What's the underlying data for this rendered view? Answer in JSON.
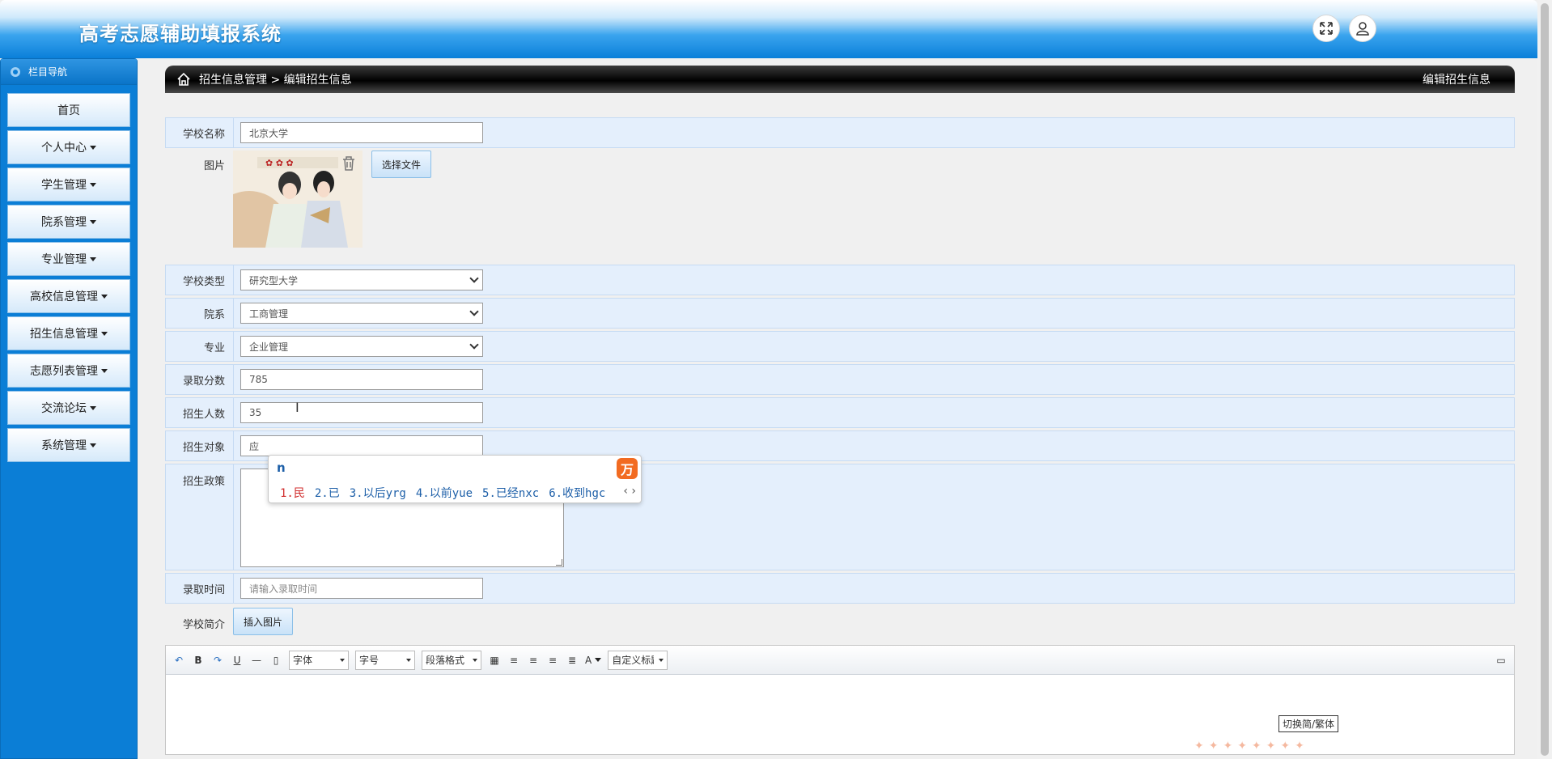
{
  "app": {
    "title": "高考志愿辅助填报系统"
  },
  "header": {
    "fullscreen_icon": "expand-arrows-icon",
    "user_icon": "user-icon"
  },
  "sidebar": {
    "heading": "栏目导航",
    "items": [
      {
        "label": "首页",
        "has_caret": false
      },
      {
        "label": "个人中心",
        "has_caret": true
      },
      {
        "label": "学生管理",
        "has_caret": true
      },
      {
        "label": "院系管理",
        "has_caret": true
      },
      {
        "label": "专业管理",
        "has_caret": true
      },
      {
        "label": "高校信息管理",
        "has_caret": true
      },
      {
        "label": "招生信息管理",
        "has_caret": true
      },
      {
        "label": "志愿列表管理",
        "has_caret": true
      },
      {
        "label": "交流论坛",
        "has_caret": true
      },
      {
        "label": "系统管理",
        "has_caret": true
      }
    ]
  },
  "breadcrumb": {
    "path": "招生信息管理 > 编辑招生信息",
    "right_title": "编辑招生信息"
  },
  "form": {
    "school_name": {
      "label": "学校名称",
      "value": "北京大学"
    },
    "image": {
      "label": "图片",
      "choose_button": "选择文件"
    },
    "school_type": {
      "label": "学校类型",
      "value": "研究型大学"
    },
    "department": {
      "label": "院系",
      "value": "工商管理"
    },
    "major": {
      "label": "专业",
      "value": "企业管理"
    },
    "admission_score": {
      "label": "录取分数",
      "value": "785"
    },
    "enrollment_count": {
      "label": "招生人数",
      "value": "35"
    },
    "enrollment_target": {
      "label": "招生对象",
      "value": "应"
    },
    "enrollment_policy": {
      "label": "招生政策",
      "value": ""
    },
    "admission_time": {
      "label": "录取时间",
      "placeholder": "请输入录取时间"
    },
    "school_intro": {
      "label": "学校简介",
      "insert_image_button": "插入图片"
    }
  },
  "ime": {
    "typed": "n",
    "candidates": [
      "1.民",
      "2.已",
      "3.以后yrg",
      "4.以前yue",
      "5.已经nxc",
      "6.收到hgc"
    ],
    "logo_char": "万"
  },
  "editor": {
    "toolbar": {
      "bold": "B",
      "underline": "U",
      "font_family": "字体",
      "font_size": "字号",
      "paragraph": "段落格式",
      "text_color": "A",
      "custom_title": "自定义标题"
    },
    "switch_label": "切换简/繁体"
  },
  "colors": {
    "sidebar_blue": "#0b7ed6",
    "row_bg": "#e4effc",
    "header_dark": "#000000"
  }
}
